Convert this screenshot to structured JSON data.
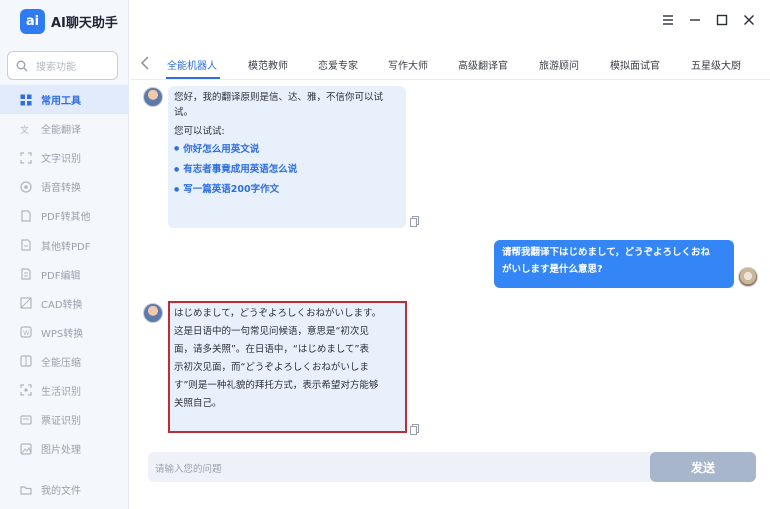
{
  "app": {
    "logo_glyph": "ai",
    "title": "AI聊天助手"
  },
  "search": {
    "placeholder": "搜索功能"
  },
  "sidebar": {
    "items": [
      {
        "label": "常用工具",
        "icon": "grid-icon",
        "active": true
      },
      {
        "label": "全能翻译",
        "icon": "translate-icon"
      },
      {
        "label": "文字识别",
        "icon": "scan-text-icon"
      },
      {
        "label": "语音转换",
        "icon": "voice-icon"
      },
      {
        "label": "PDF转其他",
        "icon": "pdf-export-icon"
      },
      {
        "label": "其他转PDF",
        "icon": "pdf-import-icon"
      },
      {
        "label": "PDF编辑",
        "icon": "pdf-edit-icon"
      },
      {
        "label": "CAD转换",
        "icon": "cad-icon"
      },
      {
        "label": "WPS转换",
        "icon": "wps-icon"
      },
      {
        "label": "全能压缩",
        "icon": "compress-icon"
      },
      {
        "label": "生活识别",
        "icon": "life-scan-icon"
      },
      {
        "label": "票证识别",
        "icon": "ticket-icon"
      },
      {
        "label": "图片处理",
        "icon": "image-icon"
      }
    ],
    "bottom": {
      "label": "我的文件",
      "icon": "folder-icon"
    }
  },
  "tabs": [
    "全能机器人",
    "模范教师",
    "恋爱专家",
    "写作大师",
    "高级翻译官",
    "旅游顾问",
    "模拟面试官",
    "五星级大厨"
  ],
  "chat": {
    "bot_intro": {
      "line1": "您好，我的翻译原则是信、达、雅，不信你可以试",
      "line2": "试。",
      "try_label": "您可以试试:",
      "suggestions": [
        "你好怎么用英文说",
        "有志者事竟成用英语怎么说",
        "写一篇英语200字作文"
      ]
    },
    "user_message": {
      "line1": "请帮我翻译下はじめまして，どうぞよろしくおね",
      "line2": "がいします是什么意思?"
    },
    "bot_reply": {
      "lines": [
        "はじめまして，どうぞよろしくおねがいします。",
        "这是日语中的一句常见问候语，意思是“初次见",
        "面，请多关照”。在日语中，“はじめまして”表",
        "示初次见面，而“どうぞよろしくおねがいしま",
        "す”则是一种礼貌的拜托方式，表示希望对方能够",
        "关照自己。"
      ]
    }
  },
  "input": {
    "placeholder": "请输入您的问题",
    "send_label": "发送"
  },
  "colors": {
    "accent": "#2f6fe0",
    "user_bubble": "#3486f6",
    "bot_bubble": "#e8f0fb",
    "highlight": "#b92f35",
    "send_disabled": "#a7b6ca"
  }
}
